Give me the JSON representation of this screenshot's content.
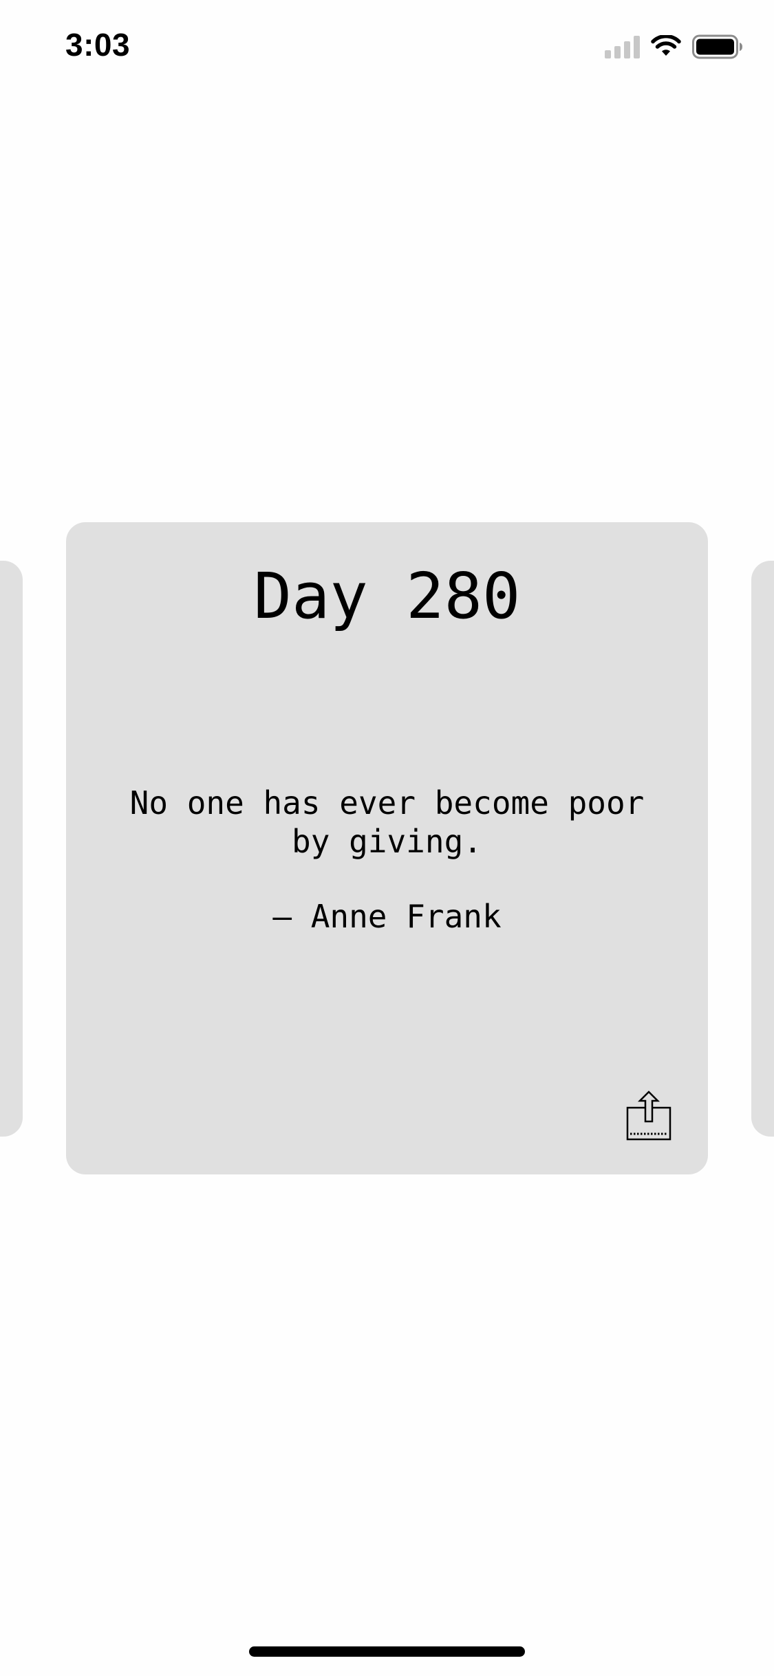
{
  "status_bar": {
    "time": "3:03",
    "icons": [
      "cellular-signal-icon",
      "wifi-icon",
      "battery-icon"
    ]
  },
  "card": {
    "title": "Day 280",
    "quote": "No one has ever become poor by giving.",
    "author": "— Anne Frank",
    "share_icon": "share-icon"
  },
  "colors": {
    "background": "#fefefe",
    "card_background": "#e0e0e0",
    "text": "#000000",
    "signal_inactive": "#c7c7c7"
  }
}
